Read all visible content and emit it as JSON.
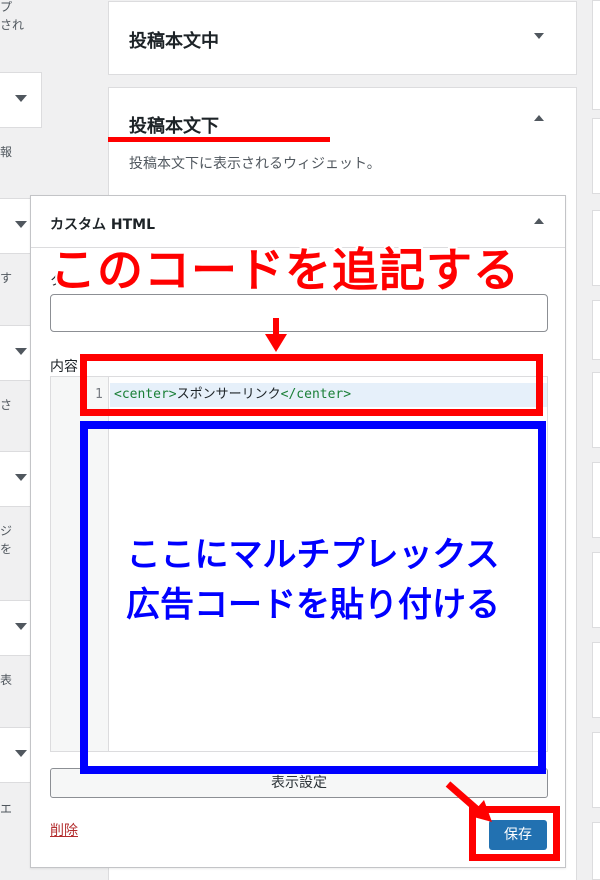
{
  "left_fragments": [
    "プ\nされ",
    "報",
    "す",
    "さ",
    "ジ\nを",
    "表",
    "エ"
  ],
  "areas": {
    "middle": {
      "title": "投稿本文中"
    },
    "bottom": {
      "title": "投稿本文下",
      "description": "投稿本文下に表示されるウィジェット。"
    }
  },
  "widget": {
    "title": "カスタム HTML",
    "title_partial_label": "タ",
    "title_value": "",
    "content_label": "内容",
    "code": {
      "line_number": "1",
      "open_tag": "<center>",
      "text": "スポンサーリンク",
      "close_tag": "</center>"
    },
    "visibility_label": "表示設定",
    "delete_label": "削除",
    "save_label": "保存"
  },
  "annotations": {
    "red_heading": "このコードを追記する",
    "blue_line1": "ここにマルチプレックス",
    "blue_line2": "広告コードを貼り付ける"
  },
  "colors": {
    "annotation_red": "#ff0000",
    "annotation_blue": "#0000ff",
    "primary_button": "#2271b1",
    "delete_link": "#b32d2e"
  }
}
